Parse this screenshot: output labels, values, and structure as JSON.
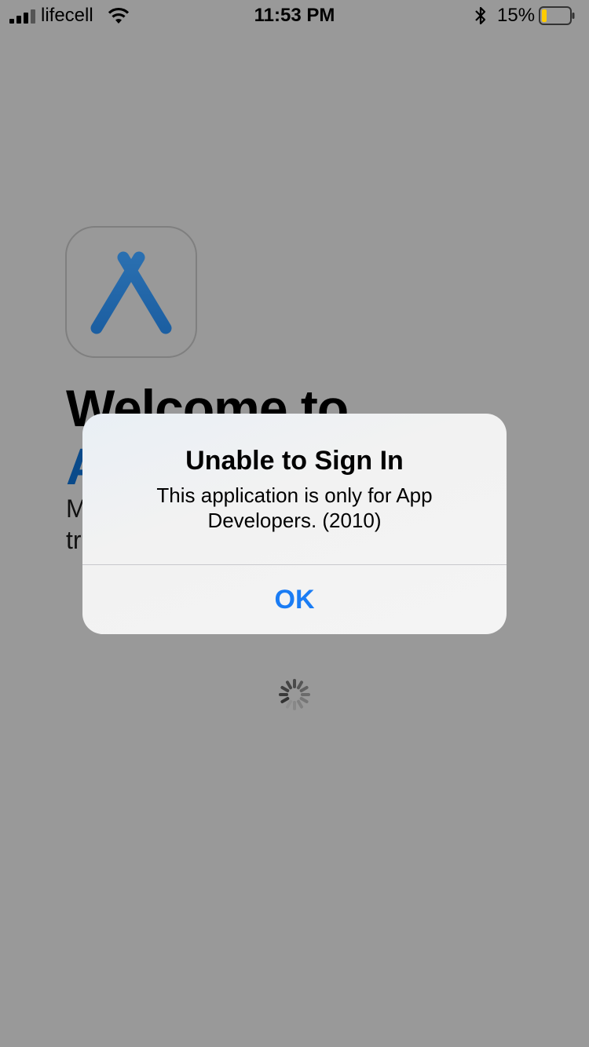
{
  "status_bar": {
    "carrier": "lifecell",
    "time": "11:53 PM",
    "battery_percent": "15%",
    "battery_level": 0.15,
    "battery_color": "#ffcc00",
    "icons": [
      "cellular-signal-icon",
      "wifi-icon",
      "bluetooth-icon",
      "battery-icon"
    ]
  },
  "background": {
    "app_icon": "app-store-connect-icon",
    "welcome_line1": "Welcome to",
    "welcome_line2_visible": "A",
    "description_line1_visible": "M",
    "description_line2_visible": "tr",
    "loading_indicator": "activity-spinner-icon"
  },
  "alert": {
    "title": "Unable to Sign In",
    "message": "This application is only for App Developers. (2010)",
    "ok_label": "OK",
    "accent_color": "#1a7cf4"
  }
}
